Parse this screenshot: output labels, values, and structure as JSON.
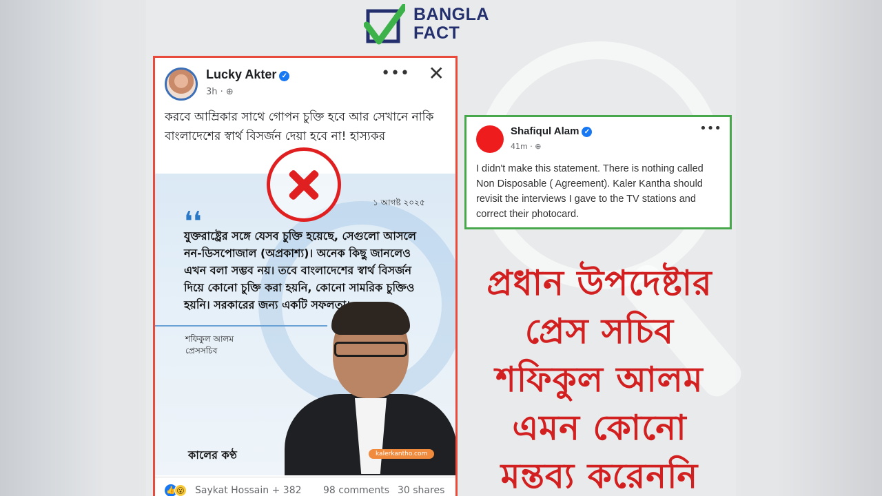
{
  "logo": {
    "brand_line1": "BANGLA",
    "brand_line2": "FACT",
    "brand_color": "#24306e",
    "check_color": "#3db24a"
  },
  "post": {
    "author": "Lucky Akter",
    "verified_icon": "verified-badge-icon",
    "time": "3h",
    "privacy_icon": "globe-icon",
    "menu_icon": "more-dots-icon",
    "close_icon": "close-icon",
    "text": "করবে আম্রিকার সাথে গোপন চুক্তি হবে আর সেখানে নাকি বাংলাদেশের স্বার্থ বিসর্জন দেয়া হবে না! হাস্যকর",
    "border_color": "#e84b3c",
    "image": {
      "fake_marker_icon": "red-x-icon",
      "date": "১ আগষ্ট ২০২৫",
      "quote_mark": "❛❛",
      "quote": "যুক্তরাষ্ট্রের সঙ্গে যেসব চুক্তি হয়েছে, সেগুলো আসলে নন-ডিসপোজাল (অপ্রকাশ্য)। অনেক কিছু জানলেও এখন বলা সম্ভব নয়। তবে বাংলাদেশের স্বার্থ বিসর্জন দিয়ে কোনো চুক্তি করা হয়নি, কোনো সামরিক চুক্তিও হয়নি। সরকারের জন্য একটি সফলতা।",
      "speaker_name": "শফিকুল আলম",
      "speaker_title": "প্রেসসচিব",
      "paper_logo": "কালের কণ্ঠ",
      "site_tag": "kalerkantho.com"
    },
    "footer": {
      "reactions_icons": [
        "like-icon",
        "wow-icon"
      ],
      "reactors": "Saykat Hossain + 382",
      "comments": "98 comments",
      "shares": "30 shares"
    }
  },
  "reply": {
    "author": "Shafiqul Alam",
    "time": "41m",
    "text": "I didn't make this statement. There is nothing called Non Disposable ( Agreement). Kaler Kantha should revisit the interviews I gave to the TV stations and correct their photocard.",
    "border_color": "#46a84a",
    "avatar_color": "#ee1c1c"
  },
  "headline": {
    "line1": "প্রধান উপদেষ্টার",
    "line2": "প্রেস সচিব",
    "line3": "শফিকুল আলম",
    "line4": "এমন কোনো",
    "line5": "মন্তব্য করেননি",
    "color": "#d21f1f"
  }
}
